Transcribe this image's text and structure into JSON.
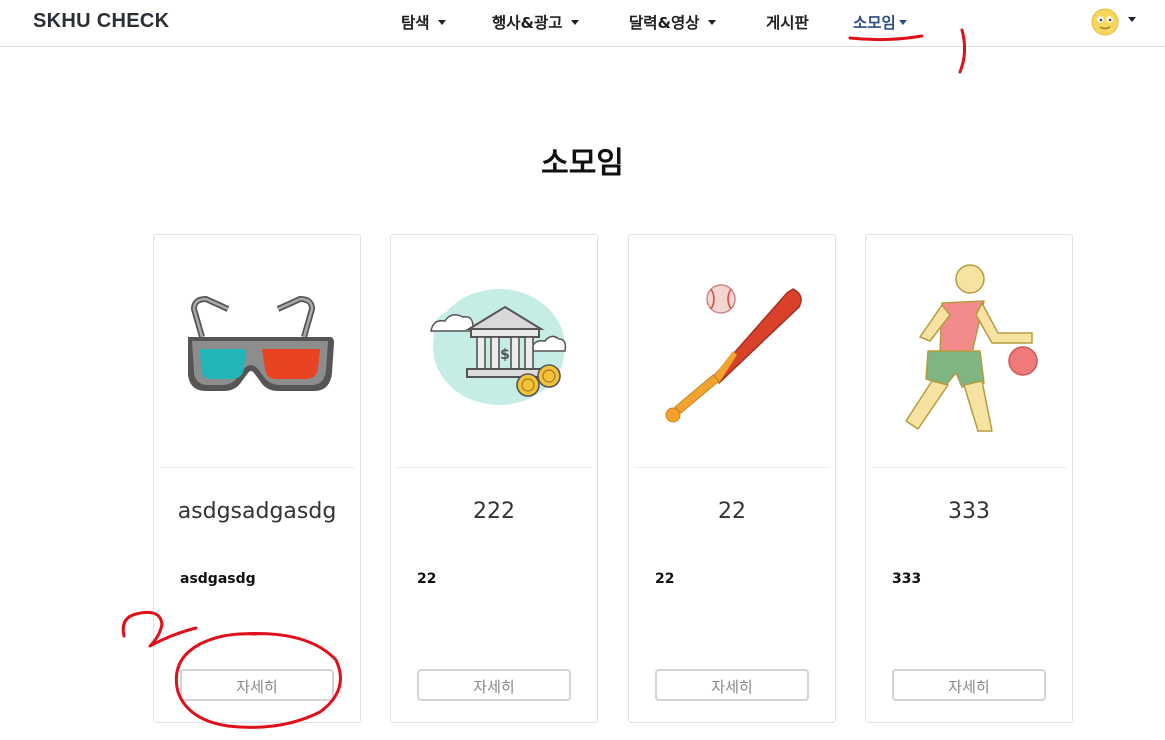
{
  "app": {
    "brand": "SKHU CHECK"
  },
  "nav": {
    "items": [
      {
        "label": "탐색"
      },
      {
        "label": "행사&광고"
      },
      {
        "label": "달력&영상"
      },
      {
        "label": "게시판"
      },
      {
        "label": "소모임"
      }
    ],
    "avatar_icon": "smiley-face-icon"
  },
  "page": {
    "title": "소모임"
  },
  "cards": [
    {
      "title": "asdgsadgasdg",
      "desc": "asdgasdg",
      "button": "자세히",
      "icon": "3d-glasses-icon"
    },
    {
      "title": "222",
      "desc": "22",
      "button": "자세히",
      "icon": "bank-coins-icon"
    },
    {
      "title": "22",
      "desc": "22",
      "button": "자세히",
      "icon": "baseball-bat-icon"
    },
    {
      "title": "333",
      "desc": "333",
      "button": "자세히",
      "icon": "basketball-player-icon"
    }
  ],
  "colors": {
    "active_nav": "#2e4f86",
    "annotation": "#e0101a"
  }
}
